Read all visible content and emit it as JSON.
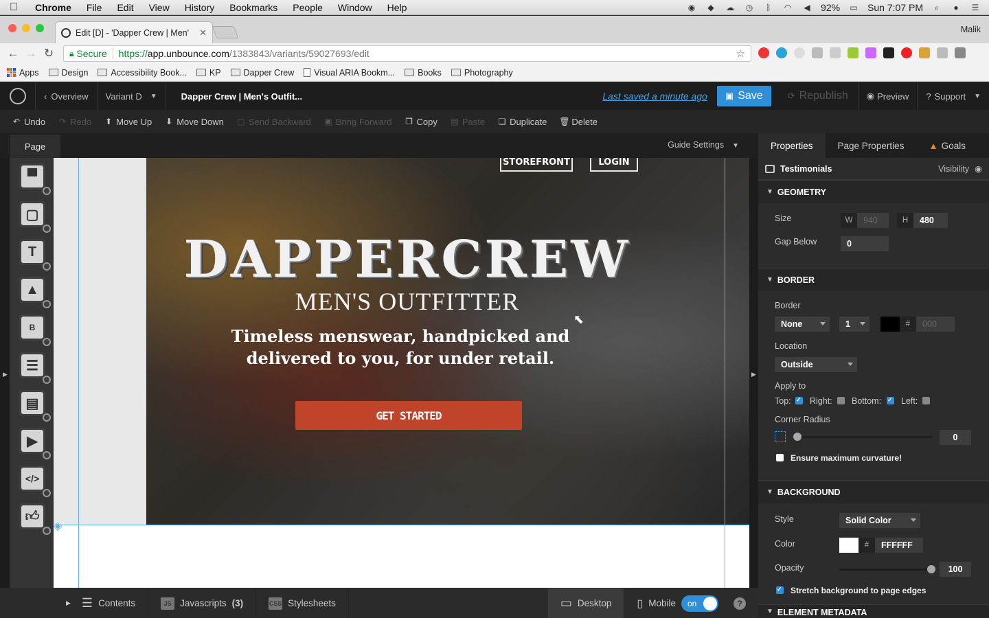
{
  "menubar": {
    "items": [
      "Chrome",
      "File",
      "Edit",
      "View",
      "History",
      "Bookmarks",
      "People",
      "Window",
      "Help"
    ],
    "battery": "92%",
    "clock": "Sun 7:07 PM"
  },
  "browser": {
    "tab_title": "Edit [D] - 'Dapper Crew | Men'",
    "profile": "Malik",
    "secure_label": "Secure",
    "url_scheme": "https://",
    "url_host": "app.unbounce.com",
    "url_path": "/1383843/variants/59027693/edit"
  },
  "bookmarks": [
    "Apps",
    "Design",
    "Accessibility Book...",
    "KP",
    "Dapper Crew",
    "Visual ARIA Bookm...",
    "Books",
    "Photography"
  ],
  "app": {
    "overview": "Overview",
    "variant": "Variant D",
    "page_title": "Dapper Crew | Men's Outfit...",
    "last_saved": "Last saved  a minute ago",
    "save": "Save",
    "republish": "Republish",
    "preview": "Preview",
    "support": "Support"
  },
  "toolbar": {
    "undo": "Undo",
    "redo": "Redo",
    "move_up": "Move Up",
    "move_down": "Move Down",
    "send_backward": "Send Backward",
    "bring_forward": "Bring Forward",
    "copy": "Copy",
    "paste": "Paste",
    "duplicate": "Duplicate",
    "delete": "Delete"
  },
  "editor": {
    "page_tab": "Page",
    "guide_settings": "Guide Settings"
  },
  "hero": {
    "nav_storefront": "STOREFRONT",
    "nav_login": "LOGIN",
    "brand": "DAPPERCREW",
    "subtitle": "MEN'S OUTFITTER",
    "tagline": "Timeless menswear, handpicked and delivered to you, for under retail.",
    "cta": "GET STARTED"
  },
  "bottombar": {
    "contents": "Contents",
    "javascripts": "Javascripts",
    "javascripts_count": "(3)",
    "stylesheets": "Stylesheets",
    "desktop": "Desktop",
    "mobile": "Mobile",
    "mobile_toggle": "on",
    "help": "?"
  },
  "panel": {
    "tabs": [
      "Properties",
      "Page Properties",
      "Goals"
    ],
    "selected_element": "Testimonials",
    "visibility": "Visibility",
    "geometry": {
      "header": "GEOMETRY",
      "size_label": "Size",
      "w_prefix": "W",
      "w_value": "940",
      "h_prefix": "H",
      "h_value": "480",
      "gap_label": "Gap Below",
      "gap_value": "0"
    },
    "border": {
      "header": "BORDER",
      "border_label": "Border",
      "style_value": "None",
      "width_value": "1",
      "color_prefix": "#",
      "color_value": "000",
      "location_label": "Location",
      "location_value": "Outside",
      "apply_label": "Apply to",
      "top": "Top:",
      "right": "Right:",
      "bottom": "Bottom:",
      "left": "Left:",
      "radius_label": "Corner Radius",
      "radius_value": "0",
      "curvature_label": "Ensure maximum curvature!"
    },
    "background": {
      "header": "BACKGROUND",
      "style_label": "Style",
      "style_value": "Solid Color",
      "color_label": "Color",
      "color_prefix": "#",
      "color_value": "FFFFFF",
      "opacity_label": "Opacity",
      "opacity_value": "100",
      "stretch_label": "Stretch background to page edges"
    },
    "metadata_header": "ELEMENT METADATA"
  },
  "colors": {
    "accent": "#2f8fd8",
    "cta": "#c0442a",
    "guide": "#5fb0e8"
  }
}
